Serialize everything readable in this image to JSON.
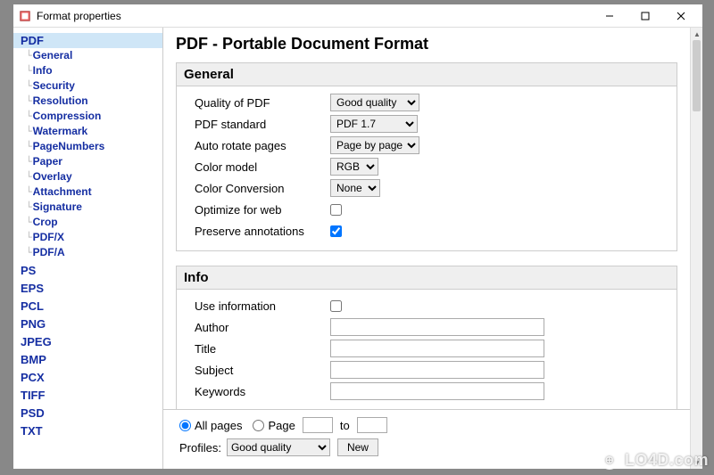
{
  "window": {
    "title": "Format properties"
  },
  "sidebar": {
    "formats": [
      {
        "label": "PDF",
        "selected": true,
        "children": [
          "General",
          "Info",
          "Security",
          "Resolution",
          "Compression",
          "Watermark",
          "PageNumbers",
          "Paper",
          "Overlay",
          "Attachment",
          "Signature",
          "Crop",
          "PDF/X",
          "PDF/A"
        ]
      },
      {
        "label": "PS"
      },
      {
        "label": "EPS"
      },
      {
        "label": "PCL"
      },
      {
        "label": "PNG"
      },
      {
        "label": "JPEG"
      },
      {
        "label": "BMP"
      },
      {
        "label": "PCX"
      },
      {
        "label": "TIFF"
      },
      {
        "label": "PSD"
      },
      {
        "label": "TXT"
      }
    ]
  },
  "page": {
    "title": "PDF - Portable Document Format"
  },
  "general": {
    "legend": "General",
    "rows": {
      "quality": {
        "label": "Quality of PDF",
        "value": "Good quality"
      },
      "standard": {
        "label": "PDF standard",
        "value": "PDF 1.7"
      },
      "autorotate": {
        "label": "Auto rotate pages",
        "value": "Page by page"
      },
      "color": {
        "label": "Color model",
        "value": "RGB"
      },
      "conv": {
        "label": "Color Conversion",
        "value": "None"
      },
      "optimize": {
        "label": "Optimize for web",
        "checked": false
      },
      "preserve": {
        "label": "Preserve annotations",
        "checked": true
      }
    }
  },
  "info": {
    "legend": "Info",
    "rows": {
      "useinfo": {
        "label": "Use information",
        "checked": false
      },
      "author": {
        "label": "Author",
        "value": ""
      },
      "title": {
        "label": "Title",
        "value": ""
      },
      "subject": {
        "label": "Subject",
        "value": ""
      },
      "keywords": {
        "label": "Keywords",
        "value": ""
      }
    }
  },
  "footer": {
    "allpages_label": "All pages",
    "page_label": "Page",
    "to_label": "to",
    "profiles_label": "Profiles:",
    "profiles_value": "Good quality",
    "new_btn": "New"
  },
  "watermark": "LO4D.com"
}
